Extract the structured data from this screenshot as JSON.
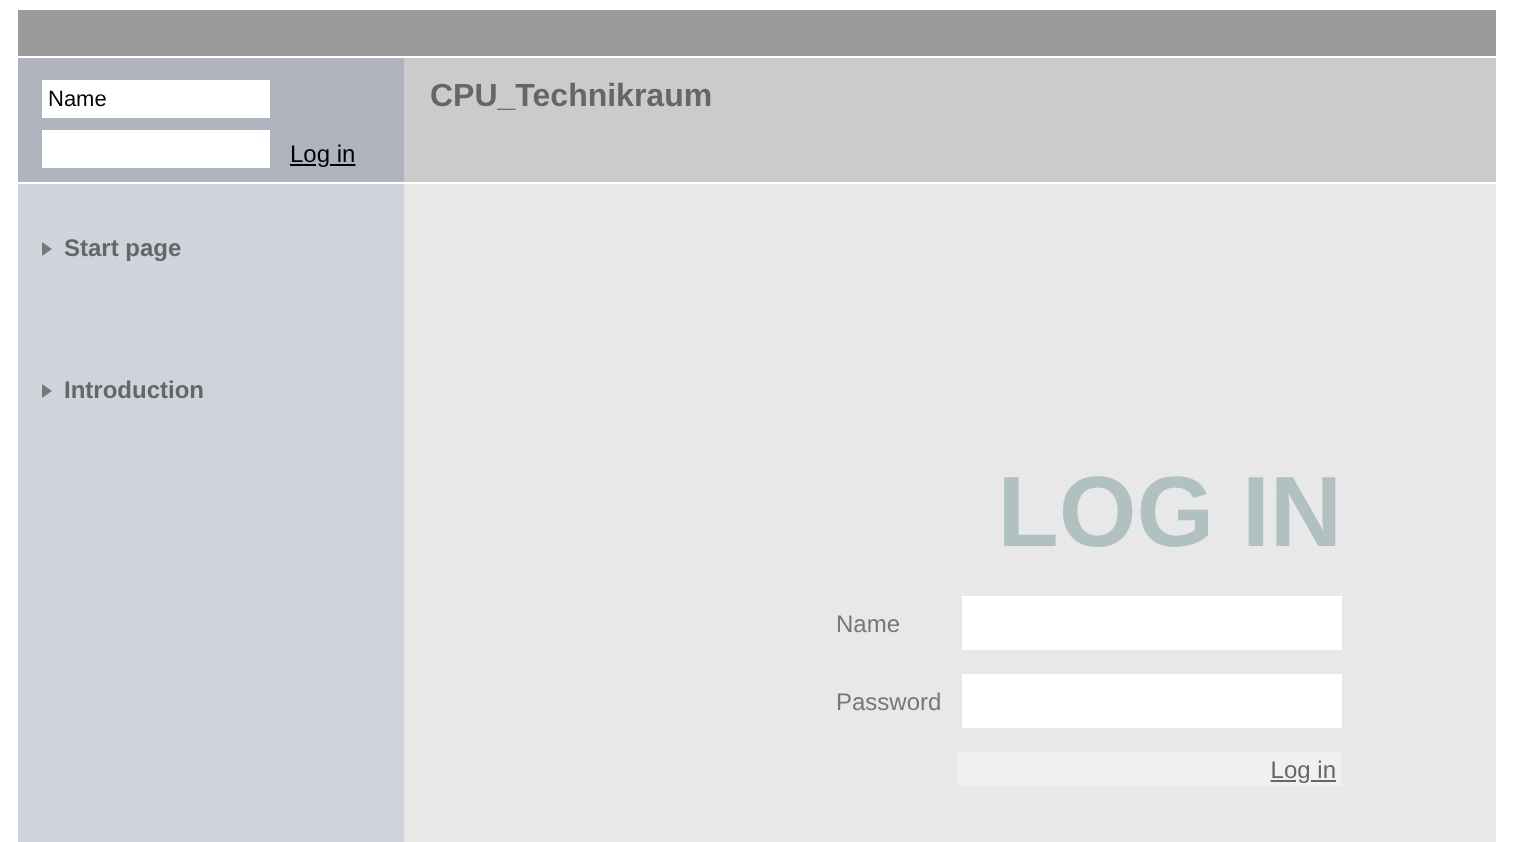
{
  "header_login": {
    "name_field": {
      "placeholder": "Name"
    },
    "link": "Log in"
  },
  "title": "CPU_Technikraum",
  "sidebar": {
    "items": [
      {
        "label": "Start page"
      },
      {
        "label": "Introduction"
      }
    ]
  },
  "login_form": {
    "heading": "LOG IN",
    "name_label": "Name",
    "password_label": "Password",
    "button": "Log in"
  }
}
